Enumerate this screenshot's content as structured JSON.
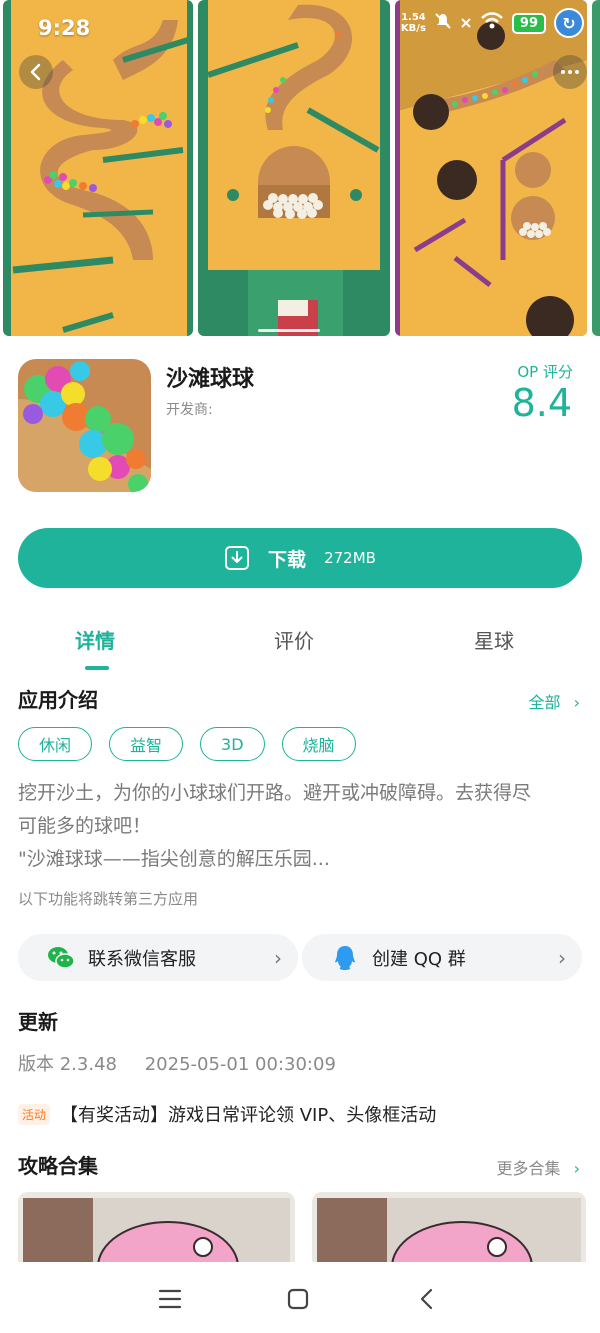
{
  "status_bar": {
    "time": "9:28",
    "net_speed_value": "1.54",
    "net_speed_unit": "KB/s",
    "battery": "99"
  },
  "app": {
    "name": "沙滩球球",
    "developer_label": "开发商:",
    "rating_label": "OP 评分",
    "rating_value": "8.4"
  },
  "download": {
    "label": "下载",
    "size": "272MB"
  },
  "tabs": [
    {
      "label": "详情",
      "active": true
    },
    {
      "label": "评价",
      "active": false
    },
    {
      "label": "星球",
      "active": false
    }
  ],
  "intro": {
    "title": "应用介绍",
    "more": "全部",
    "tags": [
      "休闲",
      "益智",
      "3D",
      "烧脑"
    ],
    "description_line1": "挖开沙土，为你的小球球们开路。避开或冲破障碍。去获得尽",
    "description_line2": "可能多的球吧！",
    "description_line3": "\"沙滩球球——指尖创意的解压乐园...",
    "third_party_note": "以下功能将跳转第三方应用"
  },
  "links": {
    "wechat": "联系微信客服",
    "qq": "创建 QQ 群"
  },
  "update": {
    "title": "更新",
    "version": "版本 2.3.48",
    "date": "2025-05-01 00:30:09",
    "activity_badge": "活动",
    "activity_text": "【有奖活动】游戏日常评论领 VIP、头像框活动"
  },
  "guides": {
    "title": "攻略合集",
    "more": "更多合集"
  },
  "colors": {
    "accent": "#1eb39a",
    "sand": "#f2b648",
    "wall_green": "#2d8b65",
    "activity": "#ff7a1a"
  }
}
